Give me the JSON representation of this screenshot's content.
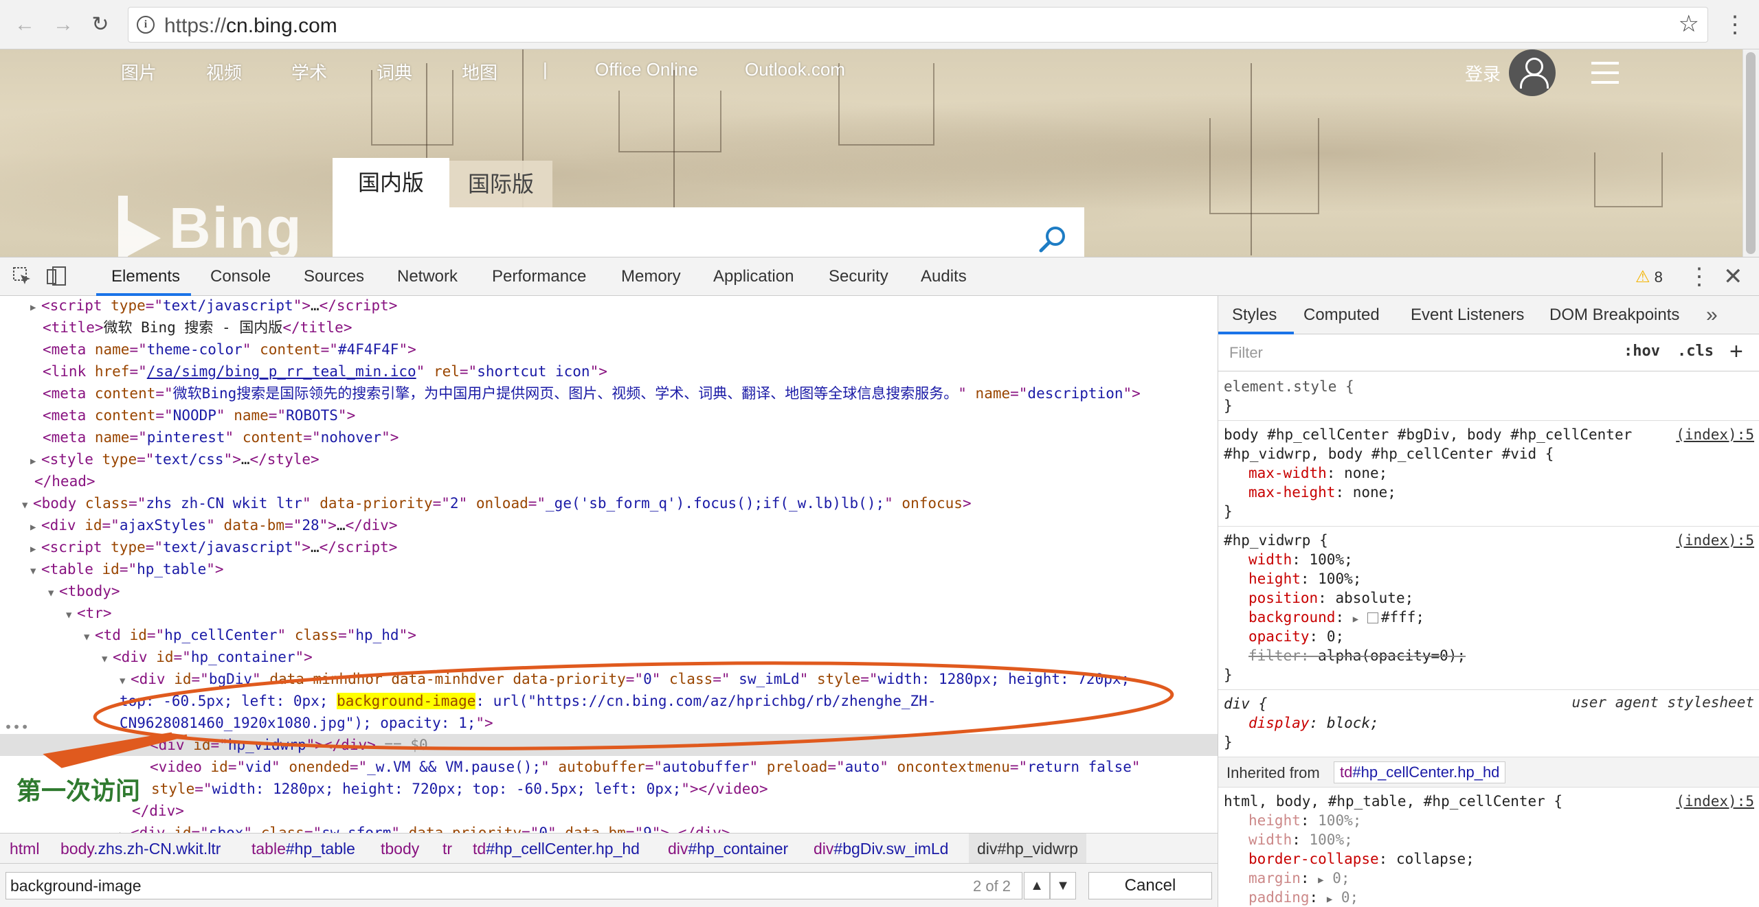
{
  "browser": {
    "url_prefix": "https://",
    "url_host": "cn.bing.com",
    "back_icon": "arrow-left",
    "forward_icon": "arrow-right",
    "reload_icon": "reload"
  },
  "bing": {
    "nav": [
      "图片",
      "视频",
      "学术",
      "词典",
      "地图",
      "|",
      "Office Online",
      "Outlook.com"
    ],
    "login": "登录",
    "tab_domestic": "国内版",
    "tab_international": "国际版",
    "logo_text": "Bing"
  },
  "devtools": {
    "tabs": [
      "Elements",
      "Console",
      "Sources",
      "Network",
      "Performance",
      "Memory",
      "Application",
      "Security",
      "Audits"
    ],
    "active_tab": "Elements",
    "warning_count": "8",
    "annotation_label": "第一次访问",
    "annotation_color": "#e05a1e",
    "breadcrumb": [
      {
        "tag": "html",
        "cls": ""
      },
      {
        "tag": "body",
        "cls": ".zhs.zh-CN.wkit.ltr"
      },
      {
        "tag": "table",
        "cls": "#hp_table"
      },
      {
        "tag": "tbody",
        "cls": ""
      },
      {
        "tag": "tr",
        "cls": ""
      },
      {
        "tag": "td",
        "cls": "#hp_cellCenter.hp_hd"
      },
      {
        "tag": "div",
        "cls": "#hp_container"
      },
      {
        "tag": "div",
        "cls": "#bgDiv.sw_imLd"
      },
      {
        "tag": "div#hp_vidwrp",
        "cls": ""
      }
    ],
    "find": {
      "query": "background-image",
      "count": "2 of 2",
      "cancel": "Cancel"
    },
    "dom_lines": [
      {
        "indent": 1,
        "tri": "r",
        "html": "<span class='tag'>&lt;script </span><span class='an'>type</span><span class='tag'>=\"</span><span class='av'>text/javascript</span><span class='tag'>\"&gt;</span><span class='txt'>…</span><span class='tag'>&lt;/script&gt;</span>"
      },
      {
        "indent": 1,
        "tri": "",
        "html": "<span class='tag'>&lt;title&gt;</span><span class='txt'>微软 Bing 搜索 - 国内版</span><span class='tag'>&lt;/title&gt;</span>"
      },
      {
        "indent": 1,
        "tri": "",
        "html": "<span class='tag'>&lt;meta </span><span class='an'>name</span><span class='tag'>=\"</span><span class='av'>theme-color</span><span class='tag'>\" </span><span class='an'>content</span><span class='tag'>=\"</span><span class='av'>#4F4F4F</span><span class='tag'>\"&gt;</span>"
      },
      {
        "indent": 1,
        "tri": "",
        "html": "<span class='tag'>&lt;link </span><span class='an'>href</span><span class='tag'>=\"</span><span class='lnk'>/sa/simg/bing_p_rr_teal_min.ico</span><span class='tag'>\" </span><span class='an'>rel</span><span class='tag'>=\"</span><span class='av'>shortcut icon</span><span class='tag'>\"&gt;</span>"
      },
      {
        "indent": 1,
        "tri": "",
        "html": "<span class='tag'>&lt;meta </span><span class='an'>content</span><span class='tag'>=\"</span><span class='av'>微软Bing搜索是国际领先的搜索引擎，为中国用户提供网页、图片、视频、学术、词典、翻译、地图等全球信息搜索服务。</span><span class='tag'>\" </span><span class='an'>name</span><span class='tag'>=\"</span><span class='av'>description</span><span class='tag'>\"&gt;</span>"
      },
      {
        "indent": 1,
        "tri": "",
        "html": "<span class='tag'>&lt;meta </span><span class='an'>content</span><span class='tag'>=\"</span><span class='av'>NOODP</span><span class='tag'>\" </span><span class='an'>name</span><span class='tag'>=\"</span><span class='av'>ROBOTS</span><span class='tag'>\"&gt;</span>"
      },
      {
        "indent": 1,
        "tri": "",
        "html": "<span class='tag'>&lt;meta </span><span class='an'>name</span><span class='tag'>=\"</span><span class='av'>pinterest</span><span class='tag'>\" </span><span class='an'>content</span><span class='tag'>=\"</span><span class='av'>nohover</span><span class='tag'>\"&gt;</span>"
      },
      {
        "indent": 1,
        "tri": "r",
        "html": "<span class='tag'>&lt;style </span><span class='an'>type</span><span class='tag'>=\"</span><span class='av'>text/css</span><span class='tag'>\"&gt;</span><span class='txt'>…</span><span class='tag'>&lt;/style&gt;</span>"
      },
      {
        "indent": 0,
        "tri": "",
        "html": "<span class='tag'>&lt;/head&gt;</span>"
      },
      {
        "indent": 0,
        "tri": "d",
        "html": "<span class='tag'>&lt;body </span><span class='an'>class</span><span class='tag'>=\"</span><span class='av'>zhs zh-CN wkit ltr</span><span class='tag'>\" </span><span class='an'>data-priority</span><span class='tag'>=\"</span><span class='av'>2</span><span class='tag'>\" </span><span class='an'>onload</span><span class='tag'>=\"</span><span class='av'>_ge('sb_form_q').focus();if(_w.lb)lb();</span><span class='tag'>\" </span><span class='an'>onfocus</span><span class='tag'>&gt;</span>"
      },
      {
        "indent": 1,
        "tri": "r",
        "html": "<span class='tag'>&lt;div </span><span class='an'>id</span><span class='tag'>=\"</span><span class='av'>ajaxStyles</span><span class='tag'>\" </span><span class='an'>data-bm</span><span class='tag'>=\"</span><span class='av'>28</span><span class='tag'>\"&gt;</span><span class='txt'>…</span><span class='tag'>&lt;/div&gt;</span>"
      },
      {
        "indent": 1,
        "tri": "r",
        "html": "<span class='tag'>&lt;script </span><span class='an'>type</span><span class='tag'>=\"</span><span class='av'>text/javascript</span><span class='tag'>\"&gt;</span><span class='txt'>…</span><span class='tag'>&lt;/script&gt;</span>"
      },
      {
        "indent": 1,
        "tri": "d",
        "html": "<span class='tag'>&lt;table </span><span class='an'>id</span><span class='tag'>=\"</span><span class='av'>hp_table</span><span class='tag'>\"&gt;</span>"
      },
      {
        "indent": 2,
        "tri": "d",
        "html": "<span class='tag'>&lt;tbody&gt;</span>"
      },
      {
        "indent": 3,
        "tri": "d",
        "html": "<span class='tag'>&lt;tr&gt;</span>"
      },
      {
        "indent": 4,
        "tri": "d",
        "html": "<span class='tag'>&lt;td </span><span class='an'>id</span><span class='tag'>=\"</span><span class='av'>hp_cellCenter</span><span class='tag'>\" </span><span class='an'>class</span><span class='tag'>=\"</span><span class='av'>hp_hd</span><span class='tag'>\"&gt;</span>"
      },
      {
        "indent": 5,
        "tri": "d",
        "html": "<span class='tag'>&lt;div </span><span class='an'>id</span><span class='tag'>=\"</span><span class='av'>hp_container</span><span class='tag'>\"&gt;</span>"
      },
      {
        "indent": 6,
        "tri": "d",
        "html": "<span class='tag'>&lt;div </span><span class='an'>id</span><span class='tag'>=\"</span><span class='av'>bgDiv</span><span class='tag'>\" </span><span class='an'>data-minhdhor</span><span class='tag'> </span><span class='an'>data-minhdver</span><span class='tag'> </span><span class='an'>data-priority</span><span class='tag'>=\"</span><span class='av'>0</span><span class='tag'>\" </span><span class='an'>class</span><span class='tag'>=\"</span><span class='av'> sw_imLd</span><span class='tag'>\" </span><span class='an'>style</span><span class='tag'>=\"</span><span class='av'>width: 1280px; height: 720px;</span>"
      },
      {
        "indent": 0,
        "tri": "",
        "pad": 174,
        "html": "<span class='av'>top: -60.5px; left: 0px; </span><span class='hl'>background-image</span><span class='av'>: url(\"https://cn.bing.com/az/hprichbg/rb/zhenghe_ZH-</span>"
      },
      {
        "indent": 0,
        "tri": "",
        "pad": 174,
        "html": "<span class='av'>CN9628081460_1920x1080.jpg\"); opacity: 1;</span><span class='tag'>\"&gt;</span>"
      },
      {
        "indent": 7,
        "tri": "",
        "selected": true,
        "html": "<span class='tag'>&lt;div </span><span class='an'>id</span><span class='tag'>=\"</span><span class='av'>hp_vidwrp</span><span class='tag'>\"&gt;&lt;/div&gt;</span><span class='eq'> == $0</span>"
      },
      {
        "indent": 7,
        "tri": "",
        "html": "<span class='tag'>&lt;video </span><span class='an'>id</span><span class='tag'>=\"</span><span class='av'>vid</span><span class='tag'>\" </span><span class='an'>onended</span><span class='tag'>=\"</span><span class='av'>_w.VM &amp;&amp; VM.pause();</span><span class='tag'>\" </span><span class='an'>autobuffer</span><span class='tag'>=\"</span><span class='av'>autobuffer</span><span class='tag'>\" </span><span class='an'>preload</span><span class='tag'>=\"</span><span class='av'>auto</span><span class='tag'>\" </span><span class='an'>oncontextmenu</span><span class='tag'>=\"</span><span class='av'>return false</span><span class='tag'>\"</span>"
      },
      {
        "indent": 0,
        "tri": "",
        "pad": 220,
        "html": "<span class='an'>style</span><span class='tag'>=\"</span><span class='av'>width: 1280px; height: 720px; top: -60.5px; left: 0px;</span><span class='tag'>\"&gt;&lt;/video&gt;</span>"
      },
      {
        "indent": 6,
        "tri": "",
        "html": "<span class='tag'>&lt;/div&gt;</span>"
      },
      {
        "indent": 6,
        "tri": "r",
        "html": "<span class='tag'>&lt;div </span><span class='an'>id</span><span class='tag'>=\"</span><span class='av'>sbox</span><span class='tag'>\" </span><span class='an'>class</span><span class='tag'>=\"</span><span class='av'>sw_sform</span><span class='tag'>\" </span><span class='an'>data-priority</span><span class='tag'>=\"</span><span class='av'>0</span><span class='tag'>\" </span><span class='an'>data-bm</span><span class='tag'>=\"</span><span class='av'>9</span><span class='tag'>\"&gt;</span><span class='txt'>…</span><span class='tag'>&lt;/div&gt;</span>"
      }
    ]
  },
  "styles_pane": {
    "tabs": [
      "Styles",
      "Computed",
      "Event Listeners",
      "DOM Breakpoints"
    ],
    "filter_placeholder": "Filter",
    "hov": ":hov",
    "cls": ".cls",
    "inherited_label": "Inherited from",
    "inherited_node_tag": "td",
    "inherited_node_cls": "#hp_cellCenter.hp_hd",
    "source": "(index):5",
    "user_agent": "user agent stylesheet",
    "rules": [
      {
        "selector": [
          "element.style {"
        ],
        "props": [],
        "source": false
      },
      {
        "selector": [
          "body #hp_cellCenter #bgDiv, body #hp_cellCenter",
          "#hp_vidwrp, body #hp_cellCenter #vid {"
        ],
        "props": [
          [
            "max-width",
            "none;"
          ],
          [
            "max-height",
            "none;"
          ]
        ],
        "source": true
      },
      {
        "selector": [
          "#hp_vidwrp {"
        ],
        "props": [
          [
            "width",
            "100%;"
          ],
          [
            "height",
            "100%;"
          ],
          [
            "position",
            "absolute;"
          ],
          [
            "background",
            "#fff;"
          ],
          [
            "opacity",
            "0;"
          ],
          [
            "filter",
            "alpha(opacity=0);"
          ]
        ],
        "source": true
      },
      {
        "selector": [
          "div {"
        ],
        "props": [
          [
            "display",
            "block;"
          ]
        ],
        "source": false
      },
      {
        "selector": [
          "html, body, #hp_table, #hp_cellCenter {"
        ],
        "props": [
          [
            "height",
            "100%;"
          ],
          [
            "width",
            "100%;"
          ],
          [
            "border-collapse",
            "collapse;"
          ],
          [
            "margin",
            "0;"
          ],
          [
            "padding",
            "0;"
          ]
        ],
        "source": true
      }
    ]
  }
}
